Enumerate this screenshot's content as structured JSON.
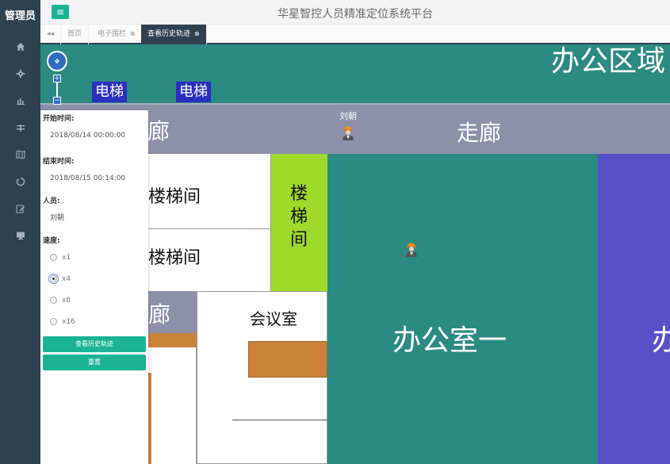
{
  "sidebar": {
    "brand": "管理员",
    "items": [
      {
        "icon": "home-icon"
      },
      {
        "icon": "gear-icon"
      },
      {
        "icon": "bar-chart-icon"
      },
      {
        "icon": "sliders-icon"
      },
      {
        "icon": "map-icon"
      },
      {
        "icon": "history-icon"
      },
      {
        "icon": "edit-icon"
      },
      {
        "icon": "monitor-icon"
      }
    ]
  },
  "header": {
    "title": "华星智控人员精准定位系统平台",
    "menu_icon": "≡"
  },
  "tabs": [
    {
      "label": "◂◂"
    },
    {
      "label": "首页"
    },
    {
      "label": "电子围栏"
    },
    {
      "label": "查看历史轨迹"
    }
  ],
  "map": {
    "rooms": {
      "office_area": "办公区域",
      "elevator_1": "电梯",
      "elevator_2": "电梯",
      "corridor_left": "廊",
      "corridor": "走廊",
      "stair_1": "楼梯间",
      "stair_2": "楼梯间",
      "stair_vertical": "楼梯间",
      "office_1": "办公室一",
      "office_right": "办",
      "meeting_room": "会议室",
      "left_fragment": "廊"
    },
    "people": [
      {
        "name": "刘朝"
      }
    ],
    "colors": {
      "teal": "#2b8a82",
      "grey": "#8c90a9",
      "purple": "#5750c7",
      "green": "#9fd92a",
      "elevator": "#2a2fc0",
      "orange": "#c9823a"
    }
  },
  "form": {
    "start_label": "开始时间:",
    "start_value": "2018/08/14 00:00:00",
    "end_label": "结束时间:",
    "end_value": "2018/08/15 00:14:00",
    "person_label": "人员:",
    "person_value": "刘朝",
    "speed_label": "速度:",
    "speeds": [
      "x1",
      "x4",
      "x8",
      "x16"
    ],
    "selected_speed": "x4",
    "query_button": "查看历史轨迹",
    "reset_button": "重置"
  }
}
